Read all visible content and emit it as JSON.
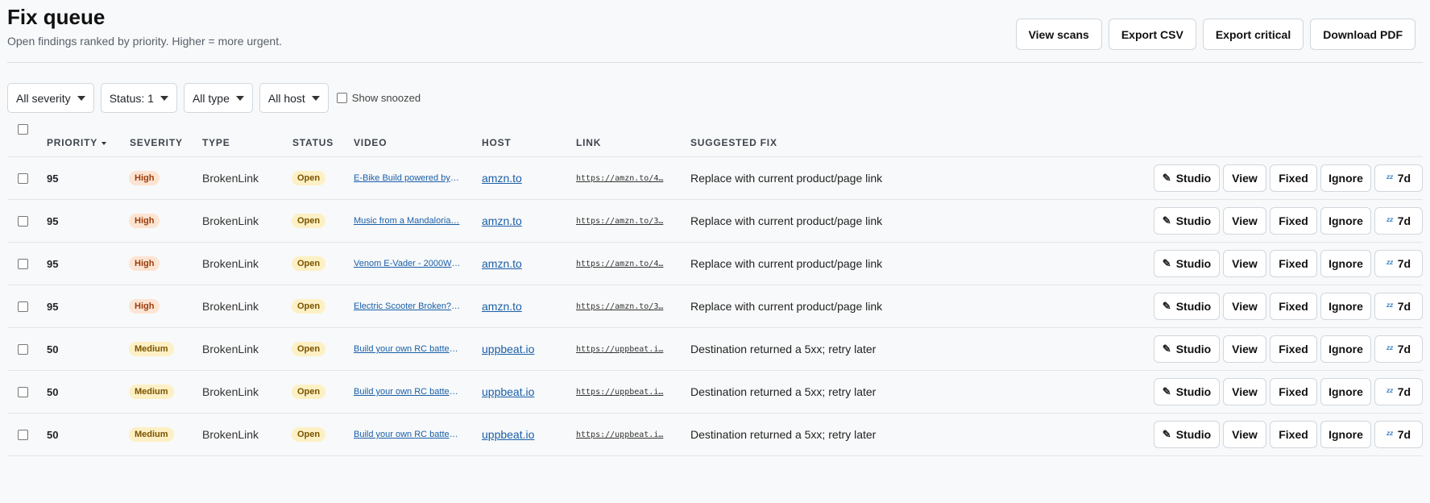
{
  "header": {
    "title": "Fix queue",
    "subtitle": "Open findings ranked by priority. Higher = more urgent.",
    "actions": [
      "View scans",
      "Export CSV",
      "Export critical",
      "Download PDF"
    ]
  },
  "filters": {
    "severity": "All severity",
    "status": "Status: 1",
    "type": "All type",
    "host": "All host",
    "show_snoozed": "Show snoozed"
  },
  "table": {
    "columns": [
      "PRIORITY",
      "SEVERITY",
      "TYPE",
      "STATUS",
      "VIDEO",
      "HOST",
      "LINK",
      "SUGGESTED FIX"
    ],
    "action_labels": {
      "studio": "Studio",
      "view": "View",
      "fixed": "Fixed",
      "ignore": "Ignore",
      "snooze": "7d"
    },
    "rows": [
      {
        "priority": "95",
        "severity": "High",
        "type": "BrokenLink",
        "status": "Open",
        "video": "E-Bike Build powered by …",
        "host": "amzn.to",
        "link": "https://amzn.to/4…",
        "fix": "Replace with current product/page link"
      },
      {
        "priority": "95",
        "severity": "High",
        "type": "BrokenLink",
        "status": "Open",
        "video": "Music from a Mandaloria…",
        "host": "amzn.to",
        "link": "https://amzn.to/3…",
        "fix": "Replace with current product/page link"
      },
      {
        "priority": "95",
        "severity": "High",
        "type": "BrokenLink",
        "status": "Open",
        "video": "Venom E-Vader - 2000W …",
        "host": "amzn.to",
        "link": "https://amzn.to/4…",
        "fix": "Replace with current product/page link"
      },
      {
        "priority": "95",
        "severity": "High",
        "type": "BrokenLink",
        "status": "Open",
        "video": "Electric Scooter Broken? …",
        "host": "amzn.to",
        "link": "https://amzn.to/3…",
        "fix": "Replace with current product/page link"
      },
      {
        "priority": "50",
        "severity": "Medium",
        "type": "BrokenLink",
        "status": "Open",
        "video": "Build your own RC batter…",
        "host": "uppbeat.io",
        "link": "https://uppbeat.i…",
        "fix": "Destination returned a 5xx; retry later"
      },
      {
        "priority": "50",
        "severity": "Medium",
        "type": "BrokenLink",
        "status": "Open",
        "video": "Build your own RC batter…",
        "host": "uppbeat.io",
        "link": "https://uppbeat.i…",
        "fix": "Destination returned a 5xx; retry later"
      },
      {
        "priority": "50",
        "severity": "Medium",
        "type": "BrokenLink",
        "status": "Open",
        "video": "Build your own RC batter…",
        "host": "uppbeat.io",
        "link": "https://uppbeat.i…",
        "fix": "Destination returned a 5xx; retry later"
      }
    ]
  },
  "colors": {
    "high_badge": "#fde4d2",
    "medium_badge": "#fdf0c4",
    "open_badge": "#fdf0c4",
    "link": "#1a5fa8"
  },
  "icons": {
    "studio": "pencil-icon",
    "snooze": "snooze-icon"
  }
}
